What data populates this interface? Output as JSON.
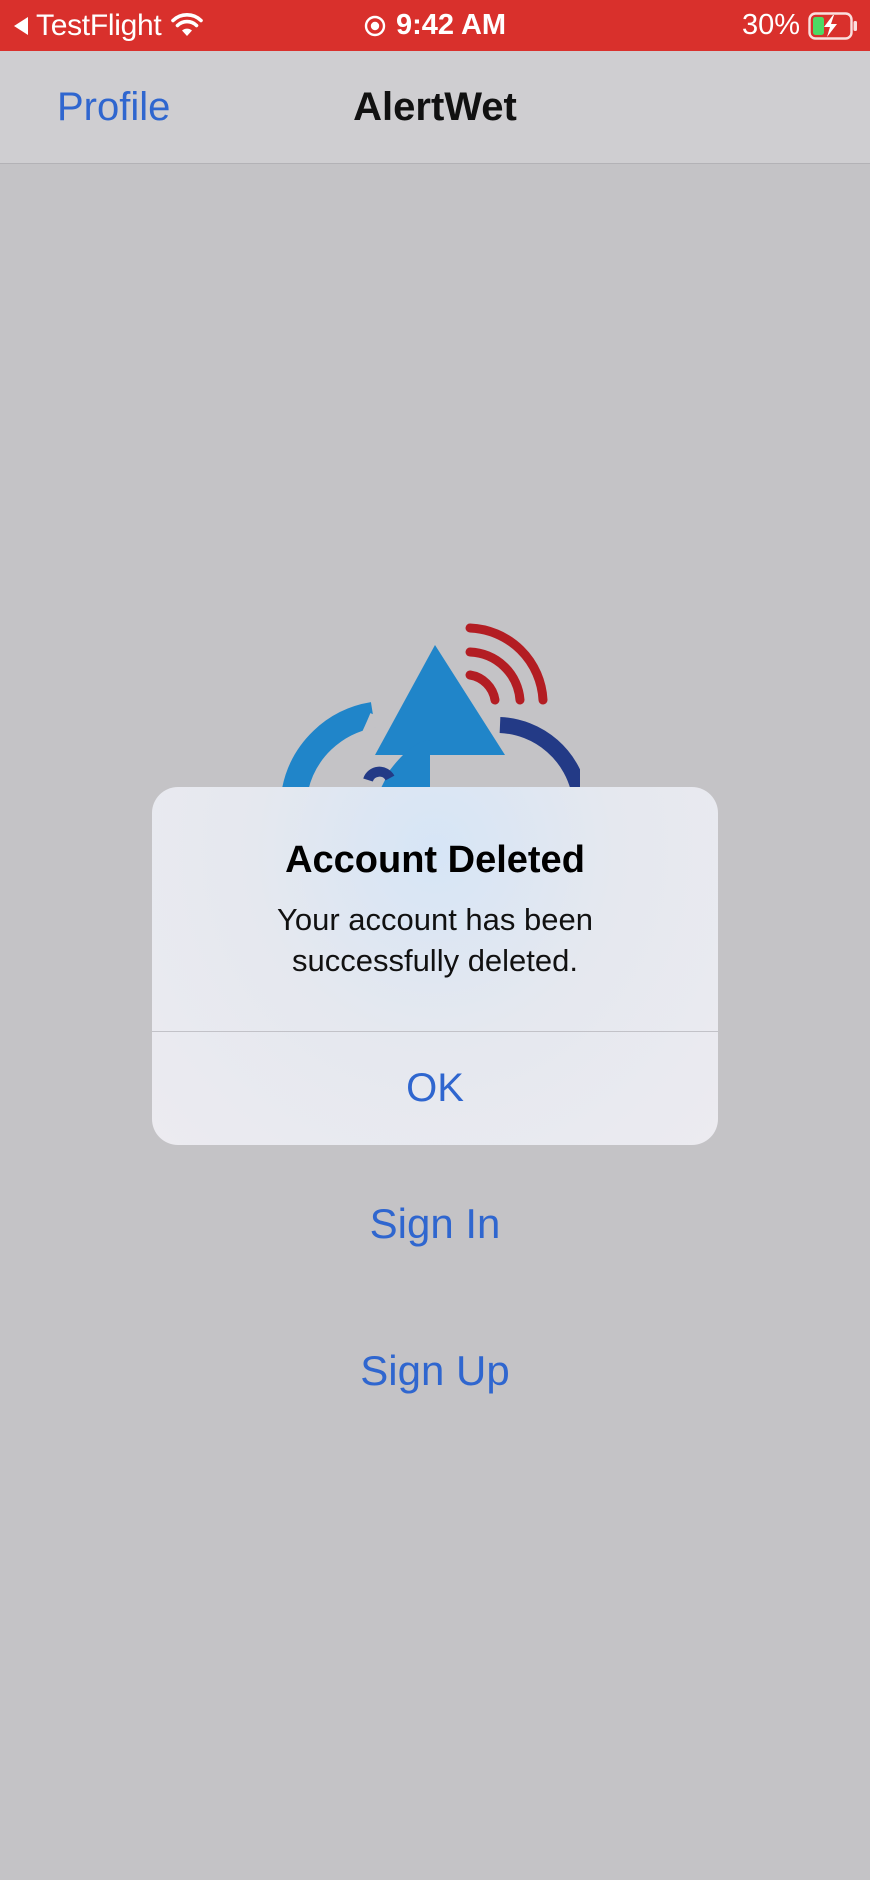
{
  "status_bar": {
    "back_app": "TestFlight",
    "time": "9:42 AM",
    "battery": "30%",
    "icons": [
      "back-arrow-icon",
      "wifi-icon",
      "location-icon",
      "battery-charging-icon"
    ]
  },
  "nav": {
    "back_label": "Profile",
    "title": "AlertWet"
  },
  "main": {
    "sign_in": "Sign In",
    "sign_up": "Sign Up"
  },
  "alert": {
    "title": "Account Deleted",
    "message": "Your account has been successfully deleted.",
    "ok": "OK"
  },
  "colors": {
    "status_bar": "#d9302c",
    "accent": "#2f66cf",
    "background": "#c4c3c6",
    "logo_blue": "#2085c9",
    "logo_navy": "#233a86",
    "logo_red": "#b31d23",
    "battery_green": "#4cd964"
  }
}
